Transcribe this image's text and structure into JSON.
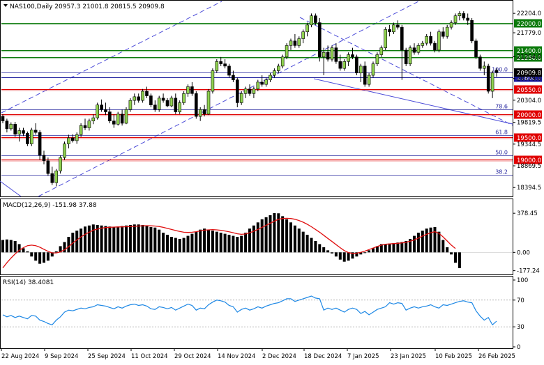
{
  "header": {
    "symbol_line": "NAS100,Daily  20957.3 21001.8 20815.5 20909.8"
  },
  "colors": {
    "bull_candle": "#8fd14f",
    "bear_candle": "#000000",
    "level_green": "#0b7a0b",
    "level_red": "#e00000",
    "level_navy": "#1a1a9c",
    "channel_blue": "#4a4ad8",
    "macd_hist": "#000000",
    "macd_signal": "#e01010",
    "rsi_line": "#1e88e5",
    "current_price_bg": "#000000"
  },
  "chart_data": [
    {
      "type": "candlestick",
      "title": "NAS100,Daily",
      "ohlc_last": {
        "open": 20957.3,
        "high": 21001.8,
        "low": 20815.5,
        "close": 20909.8
      },
      "y_ticks": [
        22204.0,
        21779.0,
        21254.0,
        20779.0,
        20304.0,
        19819.5,
        19344.5,
        18869.5,
        18394.5
      ],
      "ylim": [
        18200,
        22450
      ],
      "x_ticks": [
        "22 Aug 2024",
        "9 Sep 2024",
        "25 Sep 2024",
        "11 Oct 2024",
        "29 Oct 2024",
        "14 Nov 2024",
        "2 Dec 2024",
        "18 Dec 2024",
        "7 Jan 2025",
        "23 Jan 2025",
        "10 Feb 2025",
        "26 Feb 2025"
      ],
      "price_levels": [
        {
          "label": "22000.0",
          "value": 22000,
          "color": "green"
        },
        {
          "label": "21400.0",
          "value": 21400,
          "color": "green"
        },
        {
          "label": "21250.0",
          "value": 21250,
          "color": "green"
        },
        {
          "label": "20800.0",
          "value": 20800,
          "color": "navy"
        },
        {
          "label": "20550.0",
          "value": 20550,
          "color": "red"
        },
        {
          "label": "20000.0",
          "value": 20000,
          "color": "red"
        },
        {
          "label": "19500.0",
          "value": 19500,
          "color": "red"
        },
        {
          "label": "19000.0",
          "value": 19000,
          "color": "red"
        }
      ],
      "current_price": "20909.8",
      "fibonacci": [
        {
          "label": "100.0",
          "value": 20905
        },
        {
          "label": "78.6",
          "value": 20100
        },
        {
          "label": "61.8",
          "value": 19540
        },
        {
          "label": "50.0",
          "value": 19100
        },
        {
          "label": "38.2",
          "value": 18670
        }
      ],
      "candles": [
        [
          19950,
          20000,
          19800,
          19850
        ],
        [
          19850,
          19900,
          19600,
          19680
        ],
        [
          19680,
          19820,
          19640,
          19780
        ],
        [
          19780,
          19830,
          19500,
          19560
        ],
        [
          19560,
          19700,
          19400,
          19640
        ],
        [
          19640,
          19700,
          19520,
          19580
        ],
        [
          19580,
          19620,
          19300,
          19350
        ],
        [
          19350,
          19700,
          19300,
          19650
        ],
        [
          19650,
          19800,
          19550,
          19600
        ],
        [
          19600,
          19650,
          19000,
          19100
        ],
        [
          19100,
          19200,
          18900,
          18980
        ],
        [
          18980,
          19050,
          18650,
          18700
        ],
        [
          18700,
          18850,
          18450,
          18500
        ],
        [
          18500,
          18800,
          18420,
          18760
        ],
        [
          18760,
          19100,
          18700,
          19050
        ],
        [
          19050,
          19400,
          19000,
          19350
        ],
        [
          19350,
          19550,
          19250,
          19480
        ],
        [
          19480,
          19560,
          19380,
          19420
        ],
        [
          19420,
          19600,
          19350,
          19550
        ],
        [
          19550,
          19800,
          19500,
          19750
        ],
        [
          19750,
          19900,
          19650,
          19700
        ],
        [
          19700,
          19900,
          19640,
          19850
        ],
        [
          19850,
          20000,
          19780,
          19920
        ],
        [
          19920,
          20250,
          19880,
          20200
        ],
        [
          20200,
          20320,
          20050,
          20100
        ],
        [
          20100,
          20250,
          19980,
          20050
        ],
        [
          20050,
          20150,
          19800,
          19850
        ],
        [
          19850,
          20000,
          19700,
          19780
        ],
        [
          19780,
          20050,
          19750,
          20000
        ],
        [
          20000,
          20100,
          19750,
          19800
        ],
        [
          19800,
          20150,
          19780,
          20100
        ],
        [
          20100,
          20350,
          20050,
          20300
        ],
        [
          20300,
          20450,
          20200,
          20380
        ],
        [
          20380,
          20450,
          20250,
          20300
        ],
        [
          20300,
          20550,
          20250,
          20500
        ],
        [
          20500,
          20600,
          20350,
          20400
        ],
        [
          20400,
          20450,
          20150,
          20200
        ],
        [
          20200,
          20300,
          20050,
          20100
        ],
        [
          20100,
          20400,
          20050,
          20350
        ],
        [
          20350,
          20450,
          20250,
          20300
        ],
        [
          20300,
          20350,
          20150,
          20180
        ],
        [
          20180,
          20400,
          20150,
          20350
        ],
        [
          20350,
          20450,
          20000,
          20050
        ],
        [
          20050,
          20300,
          20000,
          20250
        ],
        [
          20250,
          20500,
          20200,
          20450
        ],
        [
          20450,
          20650,
          20380,
          20600
        ],
        [
          20600,
          20700,
          20400,
          20450
        ],
        [
          20450,
          20500,
          19900,
          19950
        ],
        [
          19950,
          20150,
          19850,
          20100
        ],
        [
          20100,
          20200,
          19950,
          20000
        ],
        [
          20000,
          20550,
          19980,
          20500
        ],
        [
          20500,
          21000,
          20450,
          20950
        ],
        [
          20950,
          21200,
          20900,
          21150
        ],
        [
          21150,
          21250,
          21050,
          21100
        ],
        [
          21100,
          21200,
          21000,
          21050
        ],
        [
          21050,
          21100,
          20800,
          20850
        ],
        [
          20850,
          20950,
          20700,
          20750
        ],
        [
          20750,
          20800,
          20150,
          20250
        ],
        [
          20250,
          20500,
          20200,
          20450
        ],
        [
          20450,
          20600,
          20350,
          20550
        ],
        [
          20550,
          20650,
          20400,
          20450
        ],
        [
          20450,
          20600,
          20350,
          20550
        ],
        [
          20550,
          20750,
          20500,
          20700
        ],
        [
          20700,
          20850,
          20600,
          20650
        ],
        [
          20650,
          20800,
          20600,
          20750
        ],
        [
          20750,
          20900,
          20700,
          20850
        ],
        [
          20850,
          21000,
          20800,
          20950
        ],
        [
          20950,
          21100,
          20900,
          21050
        ],
        [
          21050,
          21300,
          21000,
          21250
        ],
        [
          21250,
          21550,
          21200,
          21500
        ],
        [
          21500,
          21650,
          21400,
          21600
        ],
        [
          21600,
          21750,
          21450,
          21500
        ],
        [
          21500,
          21700,
          21450,
          21650
        ],
        [
          21650,
          21850,
          21550,
          21800
        ],
        [
          21800,
          22000,
          21700,
          21950
        ],
        [
          21950,
          22200,
          21900,
          22150
        ],
        [
          22150,
          22200,
          21950,
          22000
        ],
        [
          22000,
          22100,
          21150,
          21250
        ],
        [
          21250,
          21450,
          20850,
          21350
        ],
        [
          21350,
          21500,
          21150,
          21200
        ],
        [
          21200,
          21500,
          21150,
          21450
        ],
        [
          21450,
          21550,
          21100,
          21150
        ],
        [
          21150,
          21300,
          20950,
          21000
        ],
        [
          21000,
          21200,
          20950,
          21150
        ],
        [
          21150,
          21350,
          21050,
          21300
        ],
        [
          21300,
          21450,
          21200,
          21250
        ],
        [
          21250,
          21300,
          20850,
          20900
        ],
        [
          20900,
          21100,
          20700,
          21050
        ],
        [
          21050,
          21150,
          20600,
          20650
        ],
        [
          20650,
          20900,
          20600,
          20850
        ],
        [
          20850,
          21150,
          20800,
          21100
        ],
        [
          21100,
          21350,
          21050,
          21300
        ],
        [
          21300,
          21500,
          21250,
          21450
        ],
        [
          21450,
          21900,
          21400,
          21850
        ],
        [
          21850,
          21950,
          21700,
          21800
        ],
        [
          21800,
          22000,
          21750,
          21950
        ],
        [
          21950,
          22050,
          21850,
          21900
        ],
        [
          21900,
          21950,
          20750,
          21400
        ],
        [
          21400,
          21450,
          21050,
          21100
        ],
        [
          21100,
          21500,
          21050,
          21450
        ],
        [
          21450,
          21550,
          21300,
          21350
        ],
        [
          21350,
          21550,
          21300,
          21500
        ],
        [
          21500,
          21600,
          21450,
          21550
        ],
        [
          21550,
          21750,
          21500,
          21700
        ],
        [
          21700,
          21800,
          21500,
          21550
        ],
        [
          21550,
          21600,
          21350,
          21400
        ],
        [
          21400,
          21850,
          21350,
          21800
        ],
        [
          21800,
          21900,
          21650,
          21700
        ],
        [
          21700,
          21950,
          21650,
          21900
        ],
        [
          21900,
          22050,
          21850,
          22000
        ],
        [
          22000,
          22200,
          21950,
          22150
        ],
        [
          22150,
          22250,
          22050,
          22200
        ],
        [
          22200,
          22250,
          22050,
          22100
        ],
        [
          22100,
          22200,
          21950,
          22050
        ],
        [
          22050,
          22100,
          21550,
          21600
        ],
        [
          21600,
          21650,
          21200,
          21250
        ],
        [
          21250,
          21300,
          20950,
          21000
        ],
        [
          21000,
          21150,
          20850,
          21050
        ],
        [
          21050,
          21100,
          20450,
          20500
        ],
        [
          20500,
          20950,
          20350,
          20900
        ],
        [
          20957.3,
          21001.8,
          20815.5,
          20909.8
        ]
      ]
    },
    {
      "type": "bar",
      "title": "MACD(12,26,9) -151.98 37.88",
      "y_ticks": [
        378.45,
        0.0,
        -177.24
      ],
      "ylim": [
        -200,
        420
      ],
      "series": [
        {
          "values": [
            120,
            125,
            120,
            110,
            80,
            40,
            10,
            -40,
            -80,
            -110,
            -100,
            -80,
            -40,
            10,
            60,
            100,
            150,
            190,
            210,
            230,
            250,
            260,
            270,
            265,
            260,
            255,
            250,
            245,
            250,
            255,
            260,
            265,
            270,
            270,
            265,
            255,
            245,
            240,
            220,
            190,
            170,
            150,
            140,
            130,
            140,
            160,
            180,
            200,
            220,
            230,
            220,
            210,
            200,
            190,
            180,
            170,
            160,
            150,
            160,
            190,
            230,
            260,
            290,
            320,
            340,
            360,
            380,
            378,
            350,
            320,
            290,
            260,
            230,
            200,
            170,
            140,
            110,
            80,
            50,
            20,
            -10,
            -40,
            -70,
            -90,
            -80,
            -60,
            -40,
            -20,
            0,
            20,
            40,
            60,
            80,
            80,
            85,
            90,
            95,
            100,
            110,
            130,
            160,
            190,
            210,
            230,
            240,
            245,
            200,
            120,
            50,
            -20,
            -100,
            -151.98
          ]
        },
        {
          "values": [
            -150,
            -100,
            -55,
            -15,
            20,
            45,
            65,
            70,
            65,
            50,
            30,
            10,
            -5,
            -5,
            5,
            25,
            55,
            90,
            120,
            150,
            175,
            195,
            215,
            225,
            235,
            240,
            243,
            245,
            246,
            247,
            248,
            250,
            252,
            255,
            257,
            258,
            257,
            255,
            250,
            242,
            232,
            222,
            212,
            202,
            195,
            193,
            195,
            200,
            208,
            215,
            218,
            220,
            218,
            214,
            207,
            199,
            190,
            180,
            175,
            178,
            190,
            205,
            222,
            242,
            262,
            282,
            302,
            320,
            328,
            330,
            328,
            320,
            308,
            292,
            272,
            248,
            222,
            195,
            165,
            135,
            105,
            75,
            45,
            17,
            -2,
            -10,
            -8,
            0,
            12,
            27,
            42,
            57,
            70,
            78,
            82,
            85,
            88,
            92,
            98,
            108,
            120,
            138,
            158,
            175,
            190,
            200,
            185,
            150,
            110,
            70,
            37.88
          ]
        }
      ]
    },
    {
      "type": "line",
      "title": "RSI(14) 38.4081",
      "y_ticks": [
        100,
        70,
        30,
        0
      ],
      "ylim": [
        0,
        100
      ],
      "series": [
        {
          "values": [
            48,
            45,
            47,
            44,
            46,
            44,
            42,
            47,
            46,
            40,
            38,
            35,
            33,
            40,
            45,
            52,
            55,
            54,
            56,
            58,
            57,
            59,
            60,
            63,
            62,
            61,
            59,
            57,
            60,
            58,
            61,
            63,
            64,
            62,
            63,
            61,
            57,
            56,
            60,
            59,
            57,
            59,
            55,
            58,
            61,
            64,
            62,
            55,
            58,
            57,
            63,
            67,
            70,
            69,
            67,
            62,
            60,
            52,
            56,
            58,
            55,
            57,
            60,
            58,
            61,
            63,
            65,
            66,
            69,
            72,
            72,
            68,
            70,
            72,
            74,
            76,
            73,
            72,
            55,
            58,
            56,
            58,
            55,
            52,
            56,
            58,
            56,
            50,
            53,
            48,
            52,
            56,
            58,
            60,
            66,
            64,
            66,
            65,
            55,
            58,
            60,
            58,
            60,
            61,
            63,
            60,
            58,
            63,
            62,
            64,
            66,
            68,
            69,
            67,
            66,
            54,
            46,
            40,
            44,
            33,
            38.4081
          ]
        }
      ]
    }
  ]
}
